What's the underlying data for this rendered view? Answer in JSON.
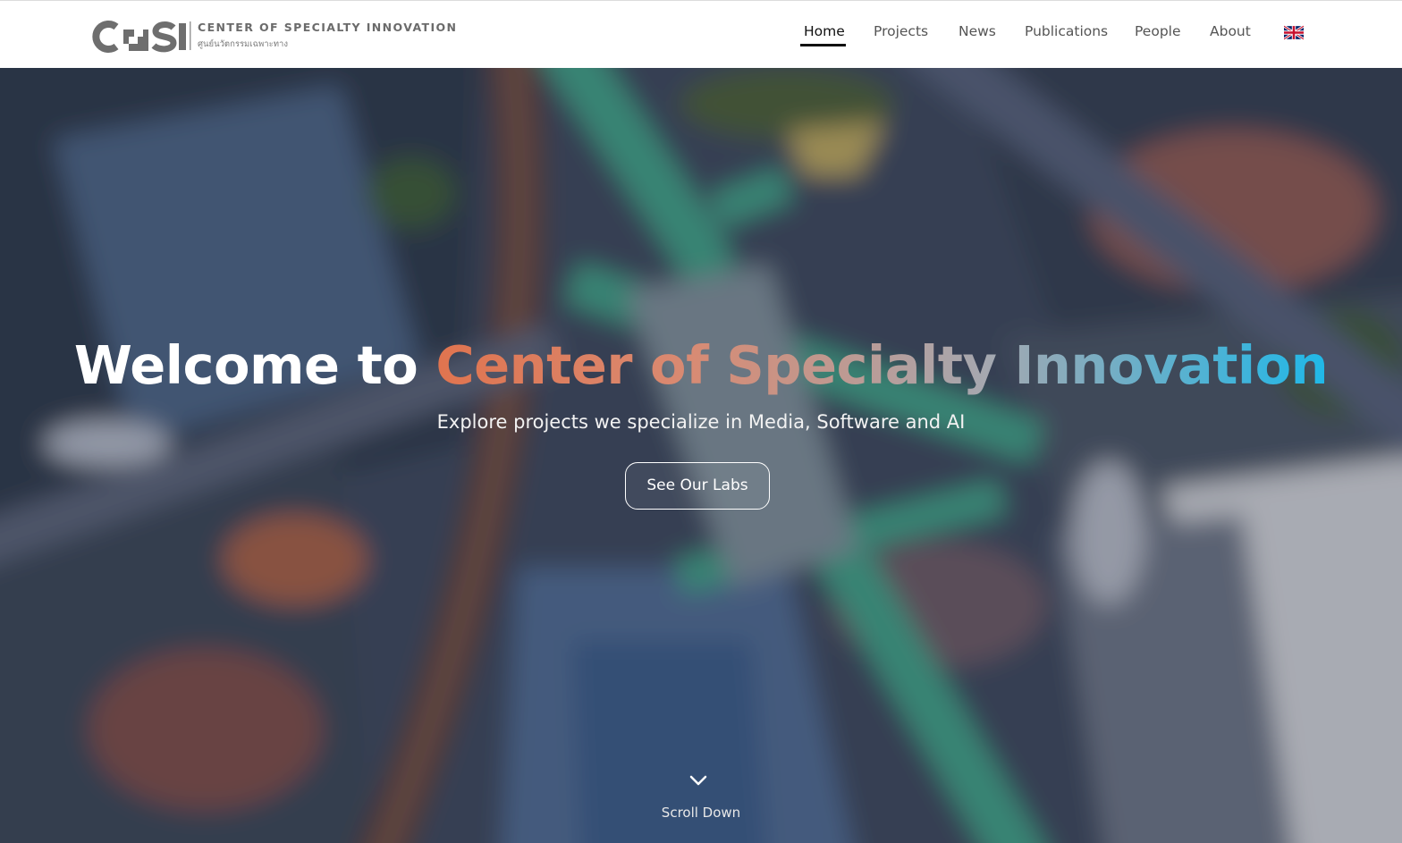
{
  "header": {
    "logo_wordmark": "COSI",
    "logo_title": "CENTER OF SPECIALTY INNOVATION",
    "logo_subtitle": "ศูนย์นวัตกรรมเฉพาะทาง",
    "nav": [
      {
        "label": "Home",
        "active": true
      },
      {
        "label": "Projects",
        "active": false
      },
      {
        "label": "News",
        "active": false
      },
      {
        "label": "Publications",
        "active": false
      },
      {
        "label": "People",
        "active": false
      },
      {
        "label": "About",
        "active": false
      }
    ],
    "language_icon": "uk-flag-icon"
  },
  "hero": {
    "title_prefix": "Welcome to",
    "title_highlight": "Center of Specialty Innovation",
    "subtitle": "Explore projects we specialize in Media, Software and AI",
    "cta_label": "See Our Labs",
    "scroll_label": "Scroll Down",
    "scroll_icon": "chevron-down-icon"
  },
  "colors": {
    "gradient_start": "#e0744f",
    "gradient_end": "#1fb8e8",
    "nav_active": "#111111",
    "nav_text": "#555555"
  }
}
